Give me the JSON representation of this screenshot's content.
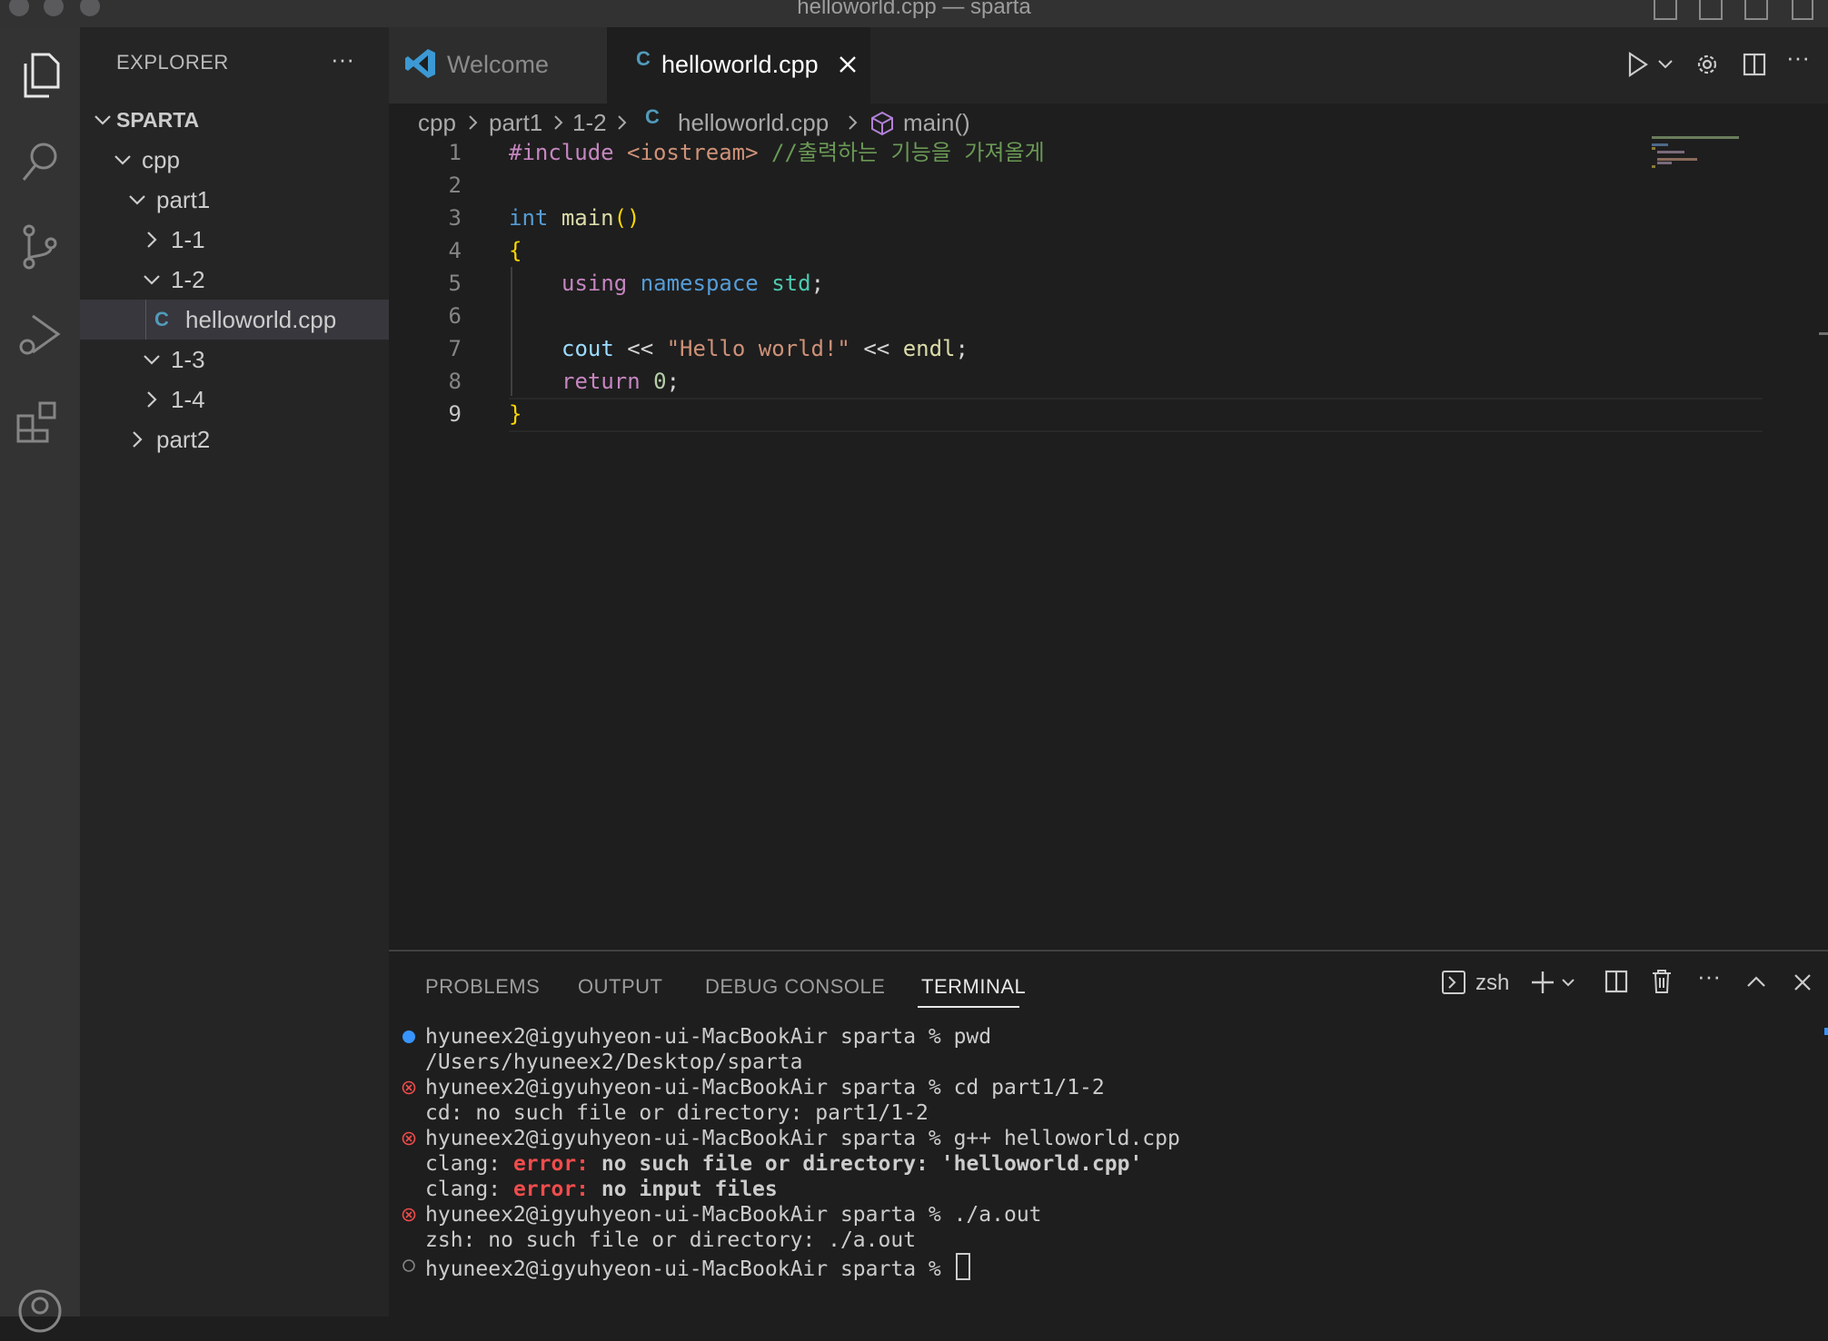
{
  "window": {
    "title": "helloworld.cpp — sparta"
  },
  "sidebar": {
    "header": "EXPLORER",
    "more": "···",
    "tree": [
      {
        "label": "SPARTA",
        "expanded": true
      },
      {
        "label": "cpp",
        "expanded": true
      },
      {
        "label": "part1",
        "expanded": true
      },
      {
        "label": "1-1",
        "expanded": false
      },
      {
        "label": "1-2",
        "expanded": true
      },
      {
        "label": "helloworld.cpp",
        "selected": true
      },
      {
        "label": "1-3",
        "expanded": true
      },
      {
        "label": "1-4",
        "expanded": false
      },
      {
        "label": "part2",
        "expanded": false
      }
    ]
  },
  "tabs": [
    {
      "label": "Welcome",
      "active": false
    },
    {
      "label": "helloworld.cpp",
      "active": true
    }
  ],
  "breadcrumb": [
    "cpp",
    "part1",
    "1-2",
    "helloworld.cpp",
    "main()"
  ],
  "editor": {
    "line_numbers": [
      "1",
      "2",
      "3",
      "4",
      "5",
      "6",
      "7",
      "8",
      "9"
    ],
    "active_line": 9,
    "lines": {
      "l1": [
        "#include",
        " <iostream>",
        " //출력하는 기능을 가져올게"
      ],
      "l3": [
        "int",
        " ",
        "main",
        "()"
      ],
      "l4": [
        "{"
      ],
      "l5": [
        "using",
        " ",
        "namespace",
        " ",
        "std",
        ";"
      ],
      "l7": [
        "cout",
        " << ",
        "\"Hello world!\"",
        " << ",
        "endl",
        ";"
      ],
      "l8": [
        "return",
        " ",
        "0",
        ";"
      ],
      "l9": [
        "}"
      ]
    }
  },
  "panel": {
    "tabs": [
      "PROBLEMS",
      "OUTPUT",
      "DEBUG CONSOLE",
      "TERMINAL"
    ],
    "active_tab": "TERMINAL",
    "shell": "zsh",
    "terminal": [
      {
        "status": "blue-dot",
        "text": "hyuneex2@igyuhyeon-ui-MacBookAir sparta % pwd"
      },
      {
        "status": "none",
        "text": "/Users/hyuneex2/Desktop/sparta"
      },
      {
        "status": "error",
        "text": "hyuneex2@igyuhyeon-ui-MacBookAir sparta % cd part1/1-2"
      },
      {
        "status": "none",
        "text": "cd: no such file or directory: part1/1-2"
      },
      {
        "status": "error",
        "text": "hyuneex2@igyuhyeon-ui-MacBookAir sparta % g++ helloworld.cpp"
      },
      {
        "status": "none",
        "parts": [
          "clang: ",
          "error:",
          " no such file or directory: 'helloworld.cpp'"
        ]
      },
      {
        "status": "none",
        "parts": [
          "clang: ",
          "error:",
          " no input files"
        ]
      },
      {
        "status": "error",
        "text": "hyuneex2@igyuhyeon-ui-MacBookAir sparta % ./a.out"
      },
      {
        "status": "none",
        "text": "zsh: no such file or directory: ./a.out"
      },
      {
        "status": "idle",
        "text": "hyuneex2@igyuhyeon-ui-MacBookAir sparta % "
      }
    ]
  },
  "colors": {
    "accent": "#007acc",
    "error": "#f14c4c",
    "cpp_icon": "#519aba"
  }
}
